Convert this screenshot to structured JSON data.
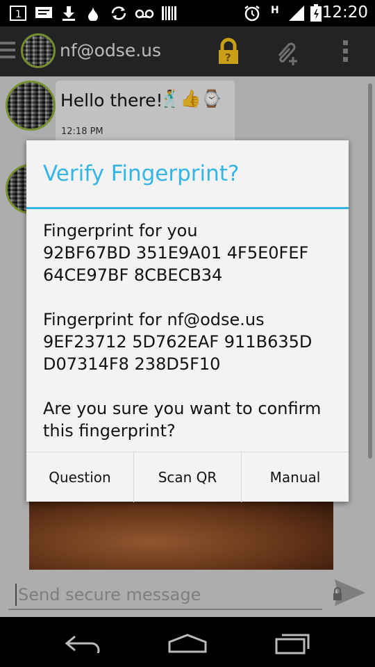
{
  "status_bar": {
    "time": "12:20",
    "network_letter": "H",
    "icons": [
      "sim-1-icon",
      "message-icon",
      "download-icon",
      "drop-icon",
      "sync-icon",
      "voicemail-icon",
      "barcode-icon",
      "alarm-icon",
      "signal-icon",
      "battery-icon"
    ]
  },
  "action_bar": {
    "title": "nf@odse.us",
    "icons": [
      "menu-icon",
      "lock-icon",
      "attach-icon",
      "overflow-menu-icon"
    ],
    "lock_color": "#f5c21b"
  },
  "conversation": {
    "messages": [
      {
        "text": "Hello there!",
        "time": "12:18 PM",
        "emoji": "🕺👍⌚"
      }
    ]
  },
  "composer": {
    "placeholder": "Send secure message"
  },
  "dialog": {
    "title": "Verify Fingerprint?",
    "accent": "#33b5e5",
    "own_label": "Fingerprint for you",
    "own_fp_line1": "92BF67BD 351E9A01 4F5E0FEF",
    "own_fp_line2": "64CE97BF 8CBECB34",
    "peer_label": "Fingerprint for nf@odse.us",
    "peer_fp_line1": "9EF23712 5D762EAF 911B635D",
    "peer_fp_line2": "D07314F8 238D5F10",
    "question_line1": "Are you sure you want to confirm",
    "question_line2": "this fingerprint?",
    "buttons": {
      "question": "Question",
      "scan": "Scan QR",
      "manual": "Manual"
    }
  },
  "nav_bar": {
    "icons": [
      "back-icon",
      "home-icon",
      "recent-apps-icon"
    ]
  }
}
